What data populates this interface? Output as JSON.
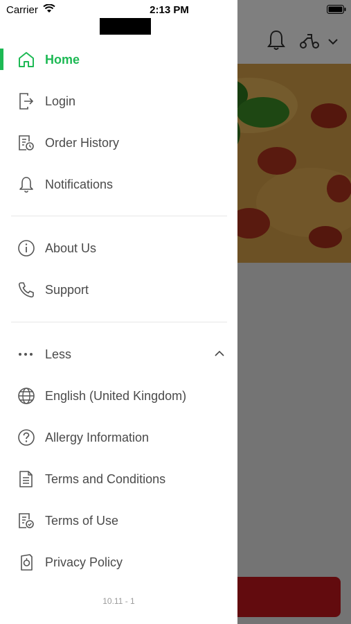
{
  "statusbar": {
    "carrier": "Carrier",
    "time": "2:13 PM"
  },
  "menu": {
    "primary": [
      {
        "label": "Home",
        "icon": "home-icon",
        "active": true
      },
      {
        "label": "Login",
        "icon": "login-icon"
      },
      {
        "label": "Order History",
        "icon": "order-history-icon"
      },
      {
        "label": "Notifications",
        "icon": "bell-icon"
      }
    ],
    "secondary": [
      {
        "label": "About Us",
        "icon": "info-icon"
      },
      {
        "label": "Support",
        "icon": "phone-icon"
      }
    ],
    "more_toggle": {
      "label": "Less",
      "icon": "more-dots-icon",
      "chevron": "chevron-up-icon"
    },
    "tertiary": [
      {
        "label": "English (United Kingdom)",
        "icon": "globe-icon"
      },
      {
        "label": "Allergy Information",
        "icon": "help-circle-icon"
      },
      {
        "label": "Terms and Conditions",
        "icon": "document-icon"
      },
      {
        "label": "Terms of Use",
        "icon": "document-check-icon"
      },
      {
        "label": "Privacy Policy",
        "icon": "privacy-icon"
      }
    ]
  },
  "version": "10.11 - 1",
  "colors": {
    "accent": "#1db954",
    "text": "#4a4a4a",
    "overlay": "rgba(0,0,0,0.5)",
    "brand_red": "#c4161c"
  }
}
